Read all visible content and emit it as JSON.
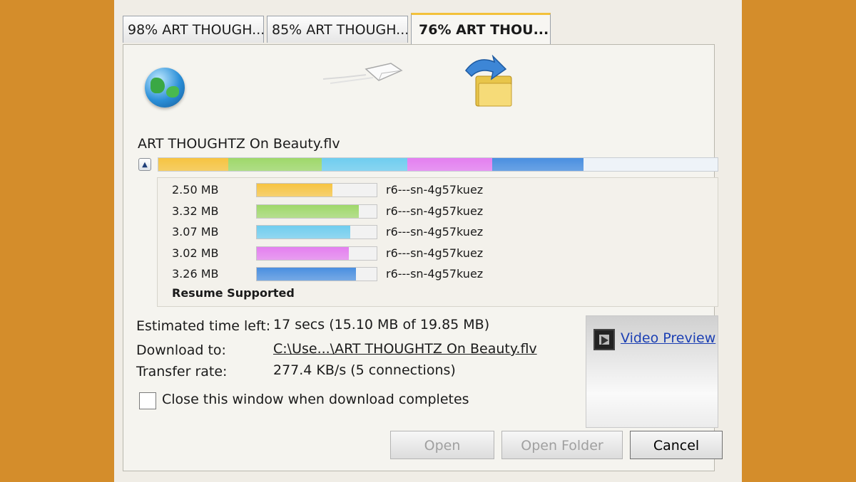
{
  "tabs": [
    {
      "label": "98% ART THOUGH..."
    },
    {
      "label": "85% ART THOUGH..."
    },
    {
      "label": "76% ART THOU..."
    }
  ],
  "file": {
    "name": "ART THOUGHTZ On Beauty.flv"
  },
  "connections": [
    {
      "size": "2.50 MB",
      "host": "r6---sn-4g57kuez",
      "progress": 0.63,
      "color": "#f7c441"
    },
    {
      "size": "3.32 MB",
      "host": "r6---sn-4g57kuez",
      "progress": 0.85,
      "color": "#9fd86a"
    },
    {
      "size": "3.07 MB",
      "host": "r6---sn-4g57kuez",
      "progress": 0.78,
      "color": "#6fcdef"
    },
    {
      "size": "3.02 MB",
      "host": "r6---sn-4g57kuez",
      "progress": 0.77,
      "color": "#e47ff0"
    },
    {
      "size": "3.26 MB",
      "host": "r6---sn-4g57kuez",
      "progress": 0.83,
      "color": "#4a8fe0"
    }
  ],
  "overall_progress": 0.76,
  "resume_text": "Resume Supported",
  "info": {
    "time_label": "Estimated time left:",
    "time_value": "17 secs (15.10 MB of 19.85 MB)",
    "download_label": "Download to:",
    "download_value": "C:\\Use...\\ART THOUGHTZ On Beauty.flv",
    "rate_label": "Transfer rate:",
    "rate_value": "277.4 KB/s (5 connections)"
  },
  "close_checkbox": {
    "label": "Close this window when download completes",
    "checked": false
  },
  "preview": {
    "label": "Video Preview"
  },
  "buttons": {
    "open": "Open",
    "open_folder": "Open Folder",
    "cancel": "Cancel"
  }
}
